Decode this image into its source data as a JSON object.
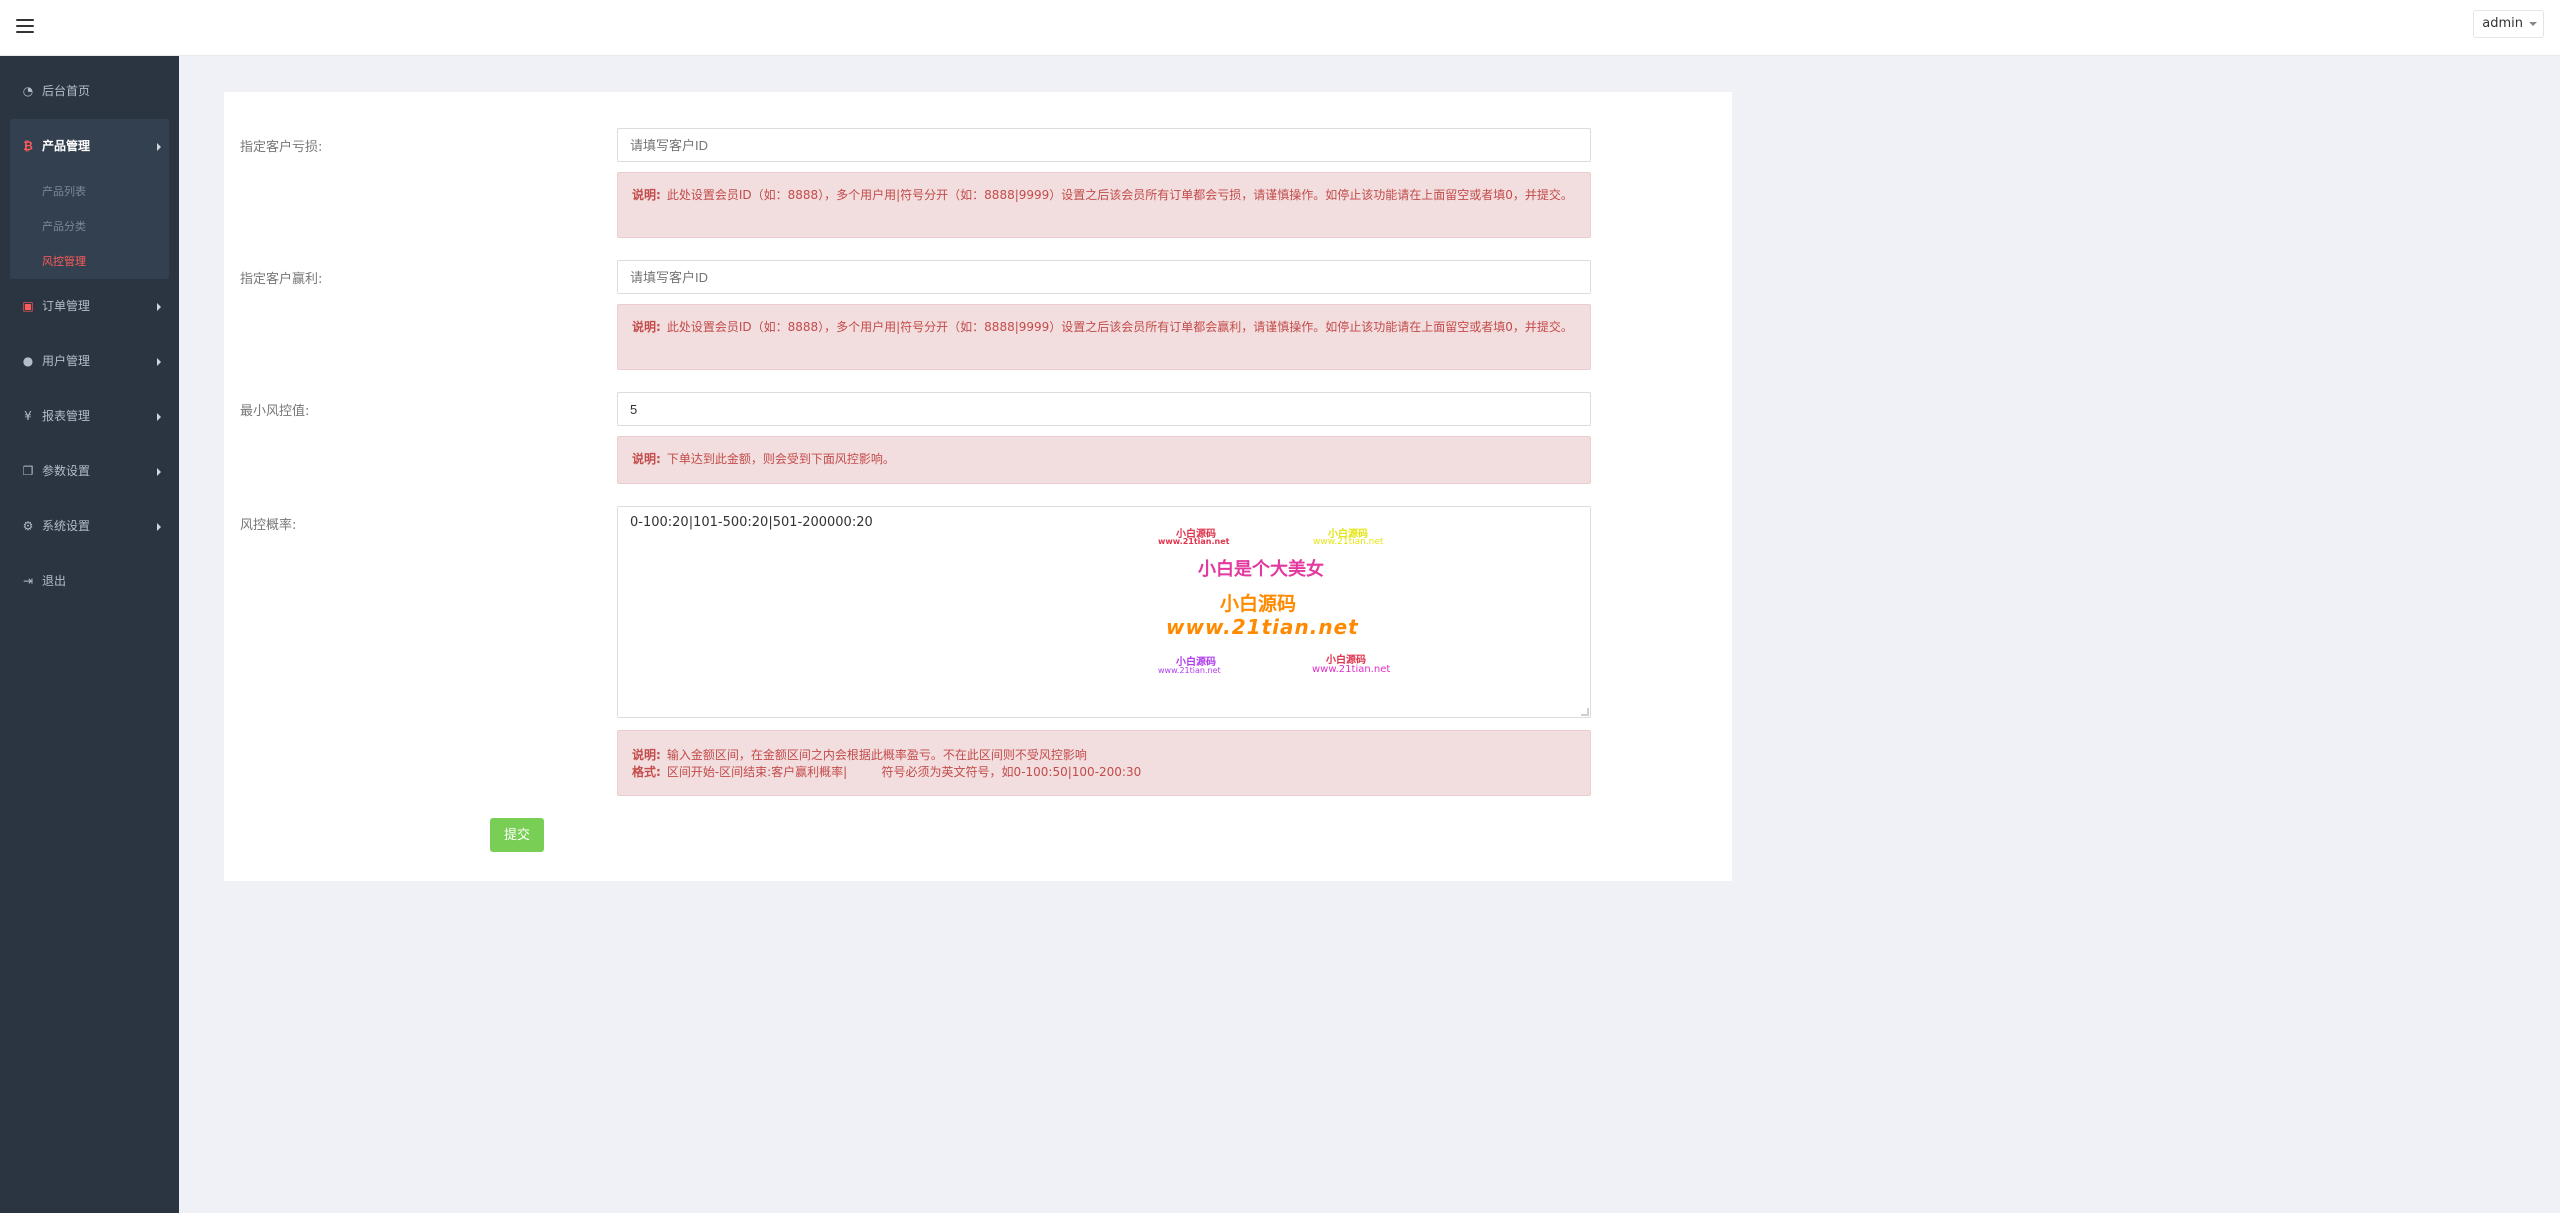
{
  "header": {
    "user": "admin"
  },
  "sidebar": {
    "items": [
      {
        "label": "后台首页",
        "icon": "dashboard-icon"
      },
      {
        "label": "产品管理",
        "icon": "bitcoin-icon"
      },
      {
        "label": "订单管理",
        "icon": "order-icon"
      },
      {
        "label": "用户管理",
        "icon": "user-icon"
      },
      {
        "label": "报表管理",
        "icon": "yen-icon"
      },
      {
        "label": "参数设置",
        "icon": "copy-icon"
      },
      {
        "label": "系统设置",
        "icon": "cogs-icon"
      },
      {
        "label": "退出",
        "icon": "sign-out-icon"
      }
    ],
    "sub_items": [
      {
        "label": "产品列表"
      },
      {
        "label": "产品分类"
      },
      {
        "label": "风控管理"
      }
    ]
  },
  "form": {
    "loss_label": "指定客户亏损:",
    "loss_placeholder": "请填写客户ID",
    "loss_note_title": "说明:",
    "loss_note": "此处设置会员ID（如：8888），多个用户用|符号分开（如：8888|9999）设置之后该会员所有订单都会亏损，请谨慎操作。如停止该功能请在上面留空或者填0，并提交。",
    "profit_label": "指定客户赢利:",
    "profit_placeholder": "请填写客户ID",
    "profit_note_title": "说明:",
    "profit_note": "此处设置会员ID（如：8888），多个用户用|符号分开（如：8888|9999）设置之后该会员所有订单都会赢利，请谨慎操作。如停止该功能请在上面留空或者填0，并提交。",
    "min_label": "最小风控值:",
    "min_value": "5",
    "min_note_title": "说明:",
    "min_note": "下单达到此金额，则会受到下面风控影响。",
    "rate_label": "风控概率:",
    "rate_value": "0-100:20|101-500:20|501-200000:20",
    "rate_note_title1": "说明:",
    "rate_note1": "输入金额区间，在金额区间之内会根据此概率盈亏。不在此区间则不受风控影响",
    "rate_note_title2": "格式:",
    "rate_note2": "区间开始-区间结束:客户赢利概率|         符号必须为英文符号，如0-100:50|100-200:30",
    "submit_label": "提交"
  },
  "watermark": {
    "a1": "小白源码",
    "a2": "www.21tian.net",
    "b1": "小白源码",
    "b2": "www.21tian.net",
    "main": "小白是个大美女",
    "big1": "小白源码",
    "big2": "www.21tian.net",
    "c1": "小白源码",
    "c2": "www.21tian.net",
    "d1": "小白源码",
    "d2": "www.21tian.net"
  }
}
